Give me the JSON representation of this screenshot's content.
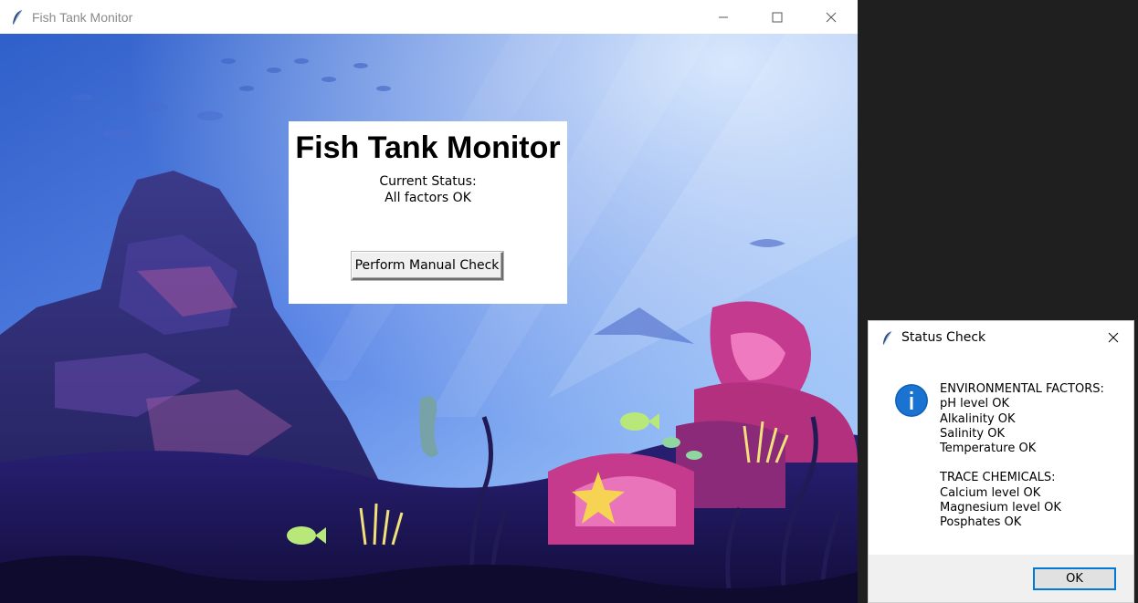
{
  "main_window": {
    "title": "Fish Tank Monitor",
    "app_icon": "feather-icon",
    "controls": [
      "minimize-icon",
      "maximize-icon",
      "close-icon"
    ]
  },
  "panel": {
    "heading": "Fish Tank Monitor",
    "status_label": "Current Status:",
    "status_value": "All factors OK",
    "button_label": "Perform Manual Check"
  },
  "dialog": {
    "title": "Status Check",
    "icon": "info-icon",
    "environmental": {
      "header": "ENVIRONMENTAL FACTORS:",
      "lines": [
        "pH level OK",
        "Alkalinity OK",
        "Salinity OK",
        "Temperature OK"
      ]
    },
    "trace": {
      "header": "TRACE CHEMICALS:",
      "lines": [
        "Calcium level OK",
        "Magnesium level OK",
        "Posphates OK"
      ]
    },
    "ok_label": "OK"
  },
  "colors": {
    "accent_blue": "#0078d7",
    "info_blue": "#1a73d1"
  }
}
